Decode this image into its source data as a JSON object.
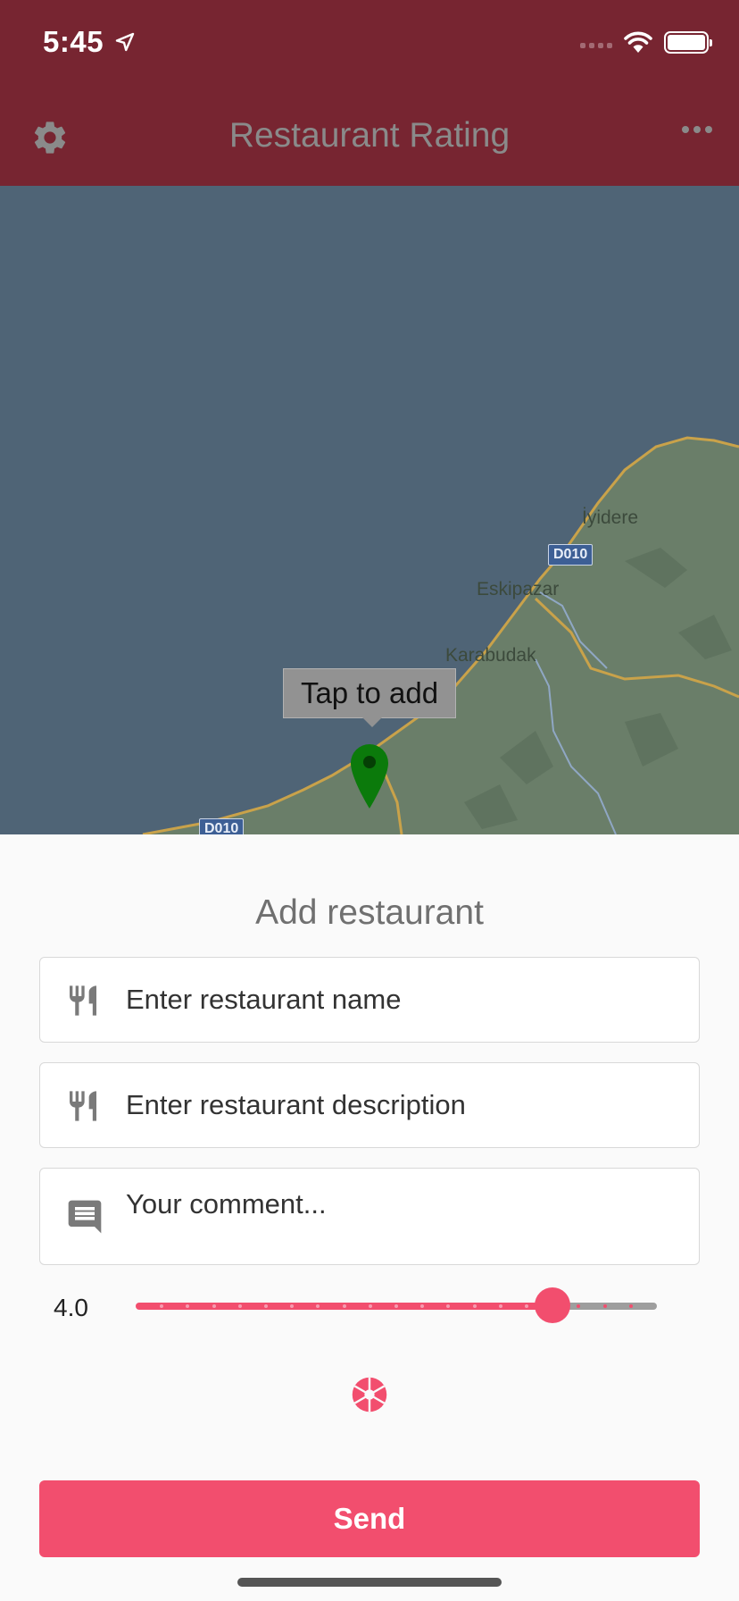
{
  "status_bar": {
    "time": "5:45"
  },
  "app_bar": {
    "title": "Restaurant Rating"
  },
  "map": {
    "labels": {
      "iyidere": "İyidere",
      "eskipazar": "Eskipazar",
      "karabudak": "Karabudak"
    },
    "road_signs": {
      "d010_upper": "D010",
      "d010_lower": "D010"
    },
    "tooltip": "Tap to add"
  },
  "form": {
    "title": "Add restaurant",
    "name_placeholder": "Enter restaurant name",
    "description_placeholder": "Enter restaurant description",
    "comment_placeholder": "Your comment...",
    "rating_label": "4.0",
    "rating_value": 4.0,
    "rating_min": 0,
    "rating_max": 5,
    "send_label": "Send"
  },
  "colors": {
    "app_bar": "#772531",
    "accent": "#f24e6e",
    "map_water": "#4f6476",
    "map_land": "#6a7e69",
    "pin": "#0b7a0b"
  },
  "icons": {
    "settings": "gear-icon",
    "more": "more-horizontal-icon",
    "name_field": "restaurant-icon",
    "description_field": "restaurant-icon",
    "comment_field": "comment-icon",
    "camera": "camera-shutter-icon"
  }
}
